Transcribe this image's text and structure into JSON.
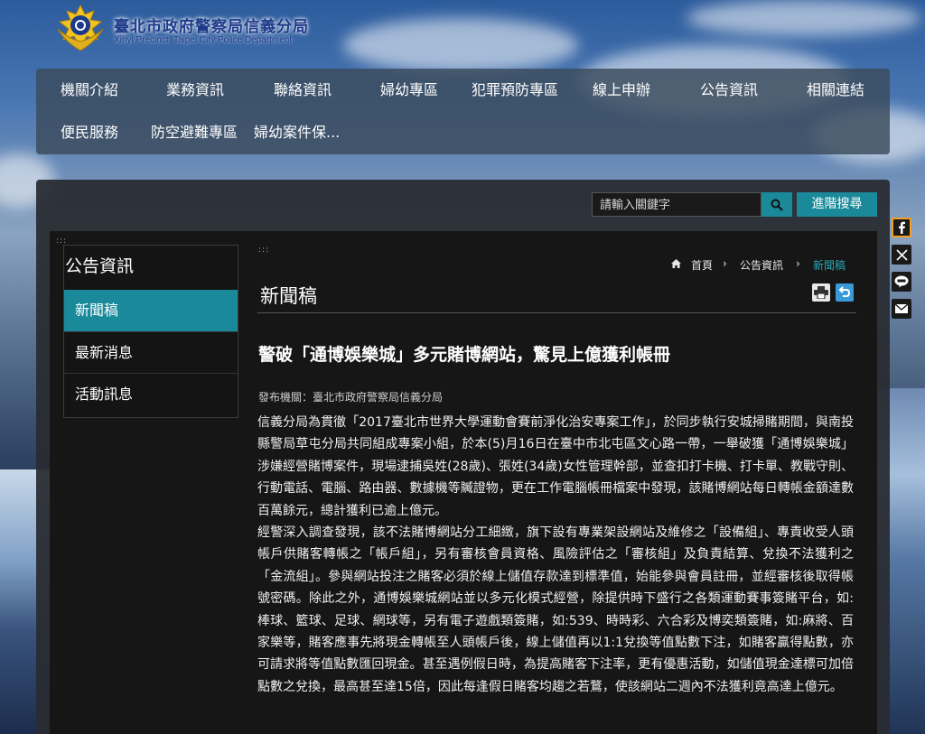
{
  "header": {
    "title": "臺北市政府警察局信義分局",
    "subtitle": "Xinyi Precinct, Taipei City Police Department"
  },
  "nav": {
    "row1": [
      "機關介紹",
      "業務資訊",
      "聯絡資訊",
      "婦幼專區",
      "犯罪預防專區",
      "線上申辦",
      "公告資訊",
      "相關連結"
    ],
    "row2": [
      "便民服務",
      "防空避難專區",
      "婦幼案件保..."
    ]
  },
  "search": {
    "placeholder": "請輸入關鍵字",
    "advanced_label": "進階搜尋"
  },
  "sidebar": {
    "title": "公告資訊",
    "items": [
      "新聞稿",
      "最新消息",
      "活動訊息"
    ],
    "active_index": 0
  },
  "breadcrumb": {
    "home": "首頁",
    "level1": "公告資訊",
    "current": "新聞稿"
  },
  "page": {
    "title": "新聞稿"
  },
  "article": {
    "title": "警破「通博娛樂城」多元賭博網站，驚見上億獲利帳冊",
    "publisher": "發布機關：臺北市政府警察局信義分局",
    "paragraphs": [
      "信義分局為貫徹「2017臺北市世界大學運動會賽前淨化治安專案工作」，於同步執行安城掃賭期間，與南投縣警局草屯分局共同組成專案小組，於本(5)月16日在臺中市北屯區文心路一帶，一舉破獲「通博娛樂城」涉嫌經營賭博案件，現場逮捕吳姓(28歲)、張姓(34歲)女性管理幹部，並查扣打卡機、打卡單、教戰守則、行動電話、電腦、路由器、數據機等贓證物，更在工作電腦帳冊檔案中發現，該賭博網站每日轉帳金額達數百萬餘元，總計獲利已逾上億元。",
      "經警深入調查發現，該不法賭博網站分工細緻，旗下設有專業架設網站及維修之「設備組」、專責收受人頭帳戶供賭客轉帳之「帳戶組」，另有審核會員資格、風險評估之「審核組」及負責結算、兌換不法獲利之「金流組」。參與網站投注之賭客必須於線上儲值存款達到標準值，始能參與會員註冊，並經審核後取得帳號密碼。除此之外，通博娛樂城網站並以多元化模式經營，除提供時下盛行之各類運動賽事簽賭平台，如:棒球、籃球、足球、網球等，另有電子遊戲類簽賭，如:539、時時彩、六合彩及博奕類簽賭，如:麻將、百家樂等，賭客應事先將現金轉帳至人頭帳戶後，線上儲值再以1:1兌換等值點數下注，如賭客贏得點數，亦可請求將等值點數匯回現金。甚至遇例假日時，為提高賭客下注率，更有優惠活動，如儲值現金達標可加倍點數之兌換，最高甚至達15倍，因此每逢假日賭客均趨之若鶩，使該網站二週內不法獲利竟高達上億元。"
    ]
  },
  "share": [
    "facebook",
    "x",
    "line",
    "email"
  ],
  "colors": {
    "accent": "#1a8a9a",
    "breadcrumb_current": "#27a9b8",
    "nav_bg": "#3a4a5c",
    "content_bg": "#161616"
  }
}
